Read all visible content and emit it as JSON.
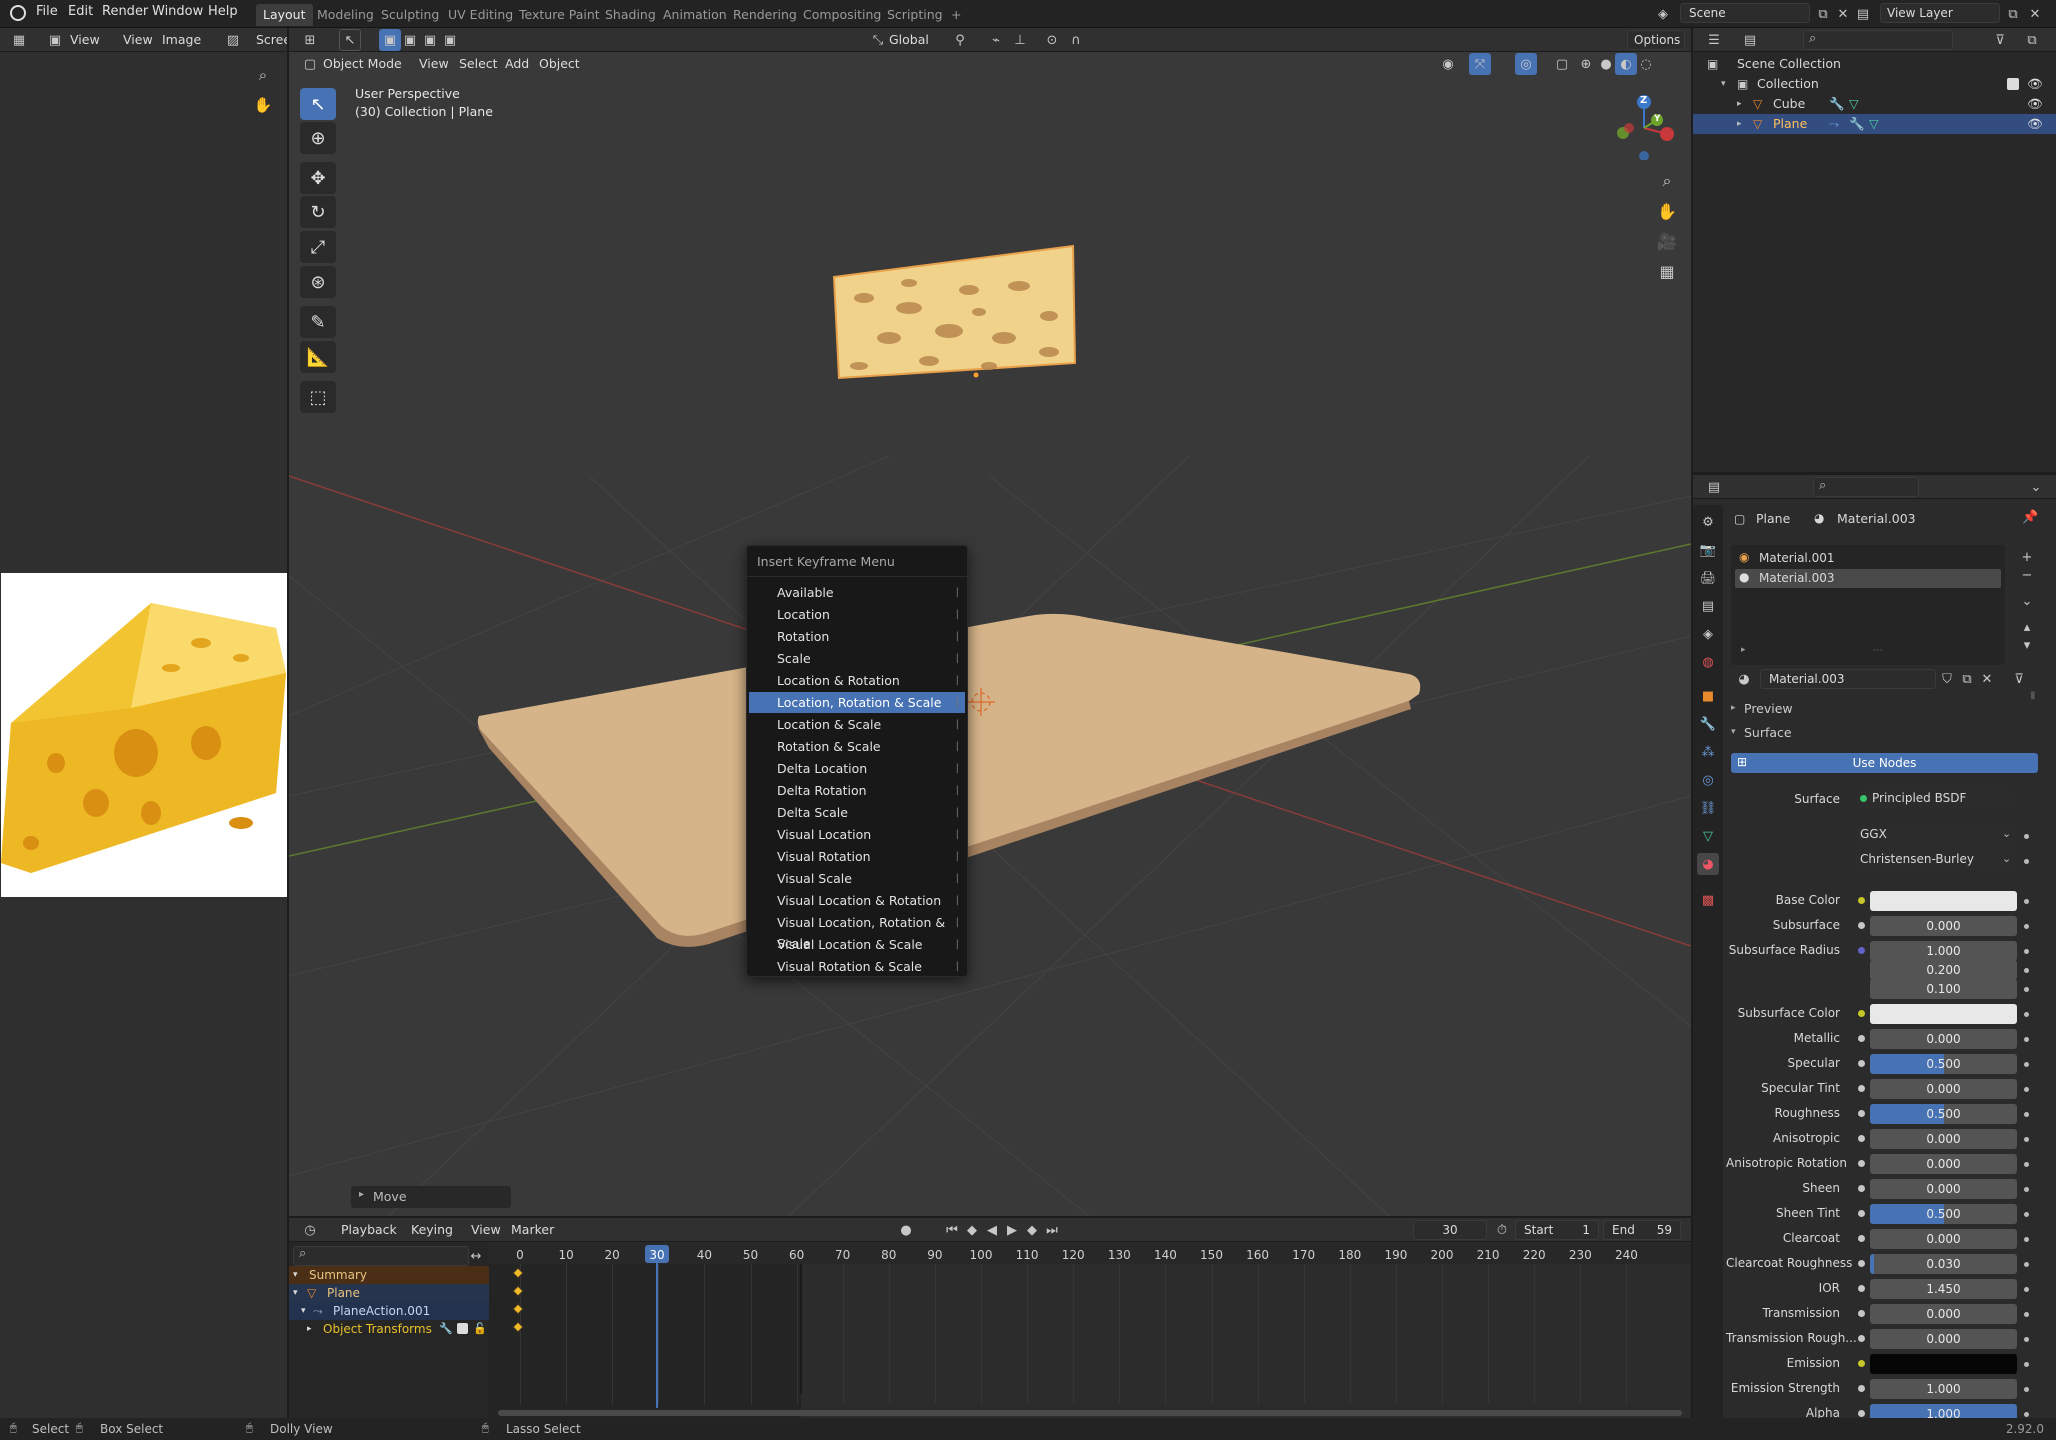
{
  "topbar": {
    "menus": [
      "File",
      "Edit",
      "Render",
      "Window",
      "Help"
    ],
    "workspaces": [
      "Layout",
      "Modeling",
      "Sculpting",
      "UV Editing",
      "Texture Paint",
      "Shading",
      "Animation",
      "Rendering",
      "Compositing",
      "Scripting"
    ],
    "active_workspace": "Layout",
    "add_tab": "+",
    "scene": "Scene",
    "view_layer": "View Layer"
  },
  "image_editor": {
    "header": {
      "view": "View",
      "view2": "View",
      "image": "Image",
      "screen": "Screen"
    }
  },
  "viewport": {
    "header": {
      "mode": "Object Mode",
      "menus": [
        "View",
        "Select",
        "Add",
        "Object"
      ],
      "orientation": "Global",
      "options": "Options"
    },
    "info_line1": "User Perspective",
    "info_line2": "(30) Collection | Plane",
    "gizmo": {
      "z": "Z",
      "y": "Y"
    },
    "last_op": "Move"
  },
  "keyframe_menu": {
    "title": "Insert Keyframe Menu",
    "items": [
      "Available",
      "Location",
      "Rotation",
      "Scale",
      "Location & Rotation",
      "Location, Rotation & Scale",
      "Location & Scale",
      "Rotation & Scale",
      "Delta Location",
      "Delta Rotation",
      "Delta Scale",
      "Visual Location",
      "Visual Rotation",
      "Visual Scale",
      "Visual Location & Rotation",
      "Visual Location, Rotation & Scale",
      "Visual Location & Scale",
      "Visual Rotation & Scale"
    ],
    "selected_index": 5
  },
  "outliner": {
    "scene_collection": "Scene Collection",
    "collection": "Collection",
    "objects": [
      "Cube",
      "Plane"
    ],
    "selected": "Plane"
  },
  "properties": {
    "object": "Plane",
    "material": "Material.003",
    "slots": [
      "Material.001",
      "Material.003"
    ],
    "material_field": "Material.003",
    "panels": {
      "preview": "Preview",
      "surface": "Surface"
    },
    "use_nodes": "Use Nodes",
    "surface_label": "Surface",
    "surface_value": "Principled BSDF",
    "distribution": "GGX",
    "subsurface_method": "Christensen-Burley",
    "rows": [
      {
        "label": "Base Color",
        "value": "",
        "color": "#e8e8e8"
      },
      {
        "label": "Subsurface",
        "value": "0.000"
      },
      {
        "label": "Subsurface Radius",
        "value": "1.000"
      },
      {
        "label": "",
        "value": "0.200"
      },
      {
        "label": "",
        "value": "0.100"
      },
      {
        "label": "Subsurface Color",
        "value": "",
        "color": "#e8e8e8"
      },
      {
        "label": "Metallic",
        "value": "0.000"
      },
      {
        "label": "Specular",
        "value": "0.500",
        "fill": 0.5
      },
      {
        "label": "Specular Tint",
        "value": "0.000"
      },
      {
        "label": "Roughness",
        "value": "0.500",
        "fill": 0.5
      },
      {
        "label": "Anisotropic",
        "value": "0.000"
      },
      {
        "label": "Anisotropic Rotation",
        "value": "0.000"
      },
      {
        "label": "Sheen",
        "value": "0.000"
      },
      {
        "label": "Sheen Tint",
        "value": "0.500",
        "fill": 0.5
      },
      {
        "label": "Clearcoat",
        "value": "0.000"
      },
      {
        "label": "Clearcoat Roughness",
        "value": "0.030",
        "fill": 0.03
      },
      {
        "label": "IOR",
        "value": "1.450"
      },
      {
        "label": "Transmission",
        "value": "0.000"
      },
      {
        "label": "Transmission Rough...",
        "value": "0.000"
      },
      {
        "label": "Emission",
        "value": "",
        "color": "#050505"
      },
      {
        "label": "Emission Strength",
        "value": "1.000"
      },
      {
        "label": "Alpha",
        "value": "1.000",
        "fill": 1.0
      }
    ]
  },
  "timeline": {
    "menus": [
      "Playback",
      "Keying",
      "View",
      "Marker"
    ],
    "current_frame": "30",
    "start_label": "Start",
    "start": "1",
    "end_label": "End",
    "end": "59",
    "ticks": [
      "0",
      "10",
      "20",
      "30",
      "40",
      "50",
      "60",
      "70",
      "80",
      "90",
      "100",
      "110",
      "120",
      "130",
      "140",
      "150",
      "160",
      "170",
      "180",
      "190",
      "200",
      "210",
      "220",
      "230",
      "240"
    ],
    "channels": [
      "Summary",
      "Plane",
      "PlaneAction.001",
      "Object Transforms"
    ]
  },
  "statusbar": {
    "select": "Select",
    "box_select": "Box Select",
    "dolly_view": "Dolly View",
    "lasso_select": "Lasso Select",
    "version": "2.92.0"
  }
}
